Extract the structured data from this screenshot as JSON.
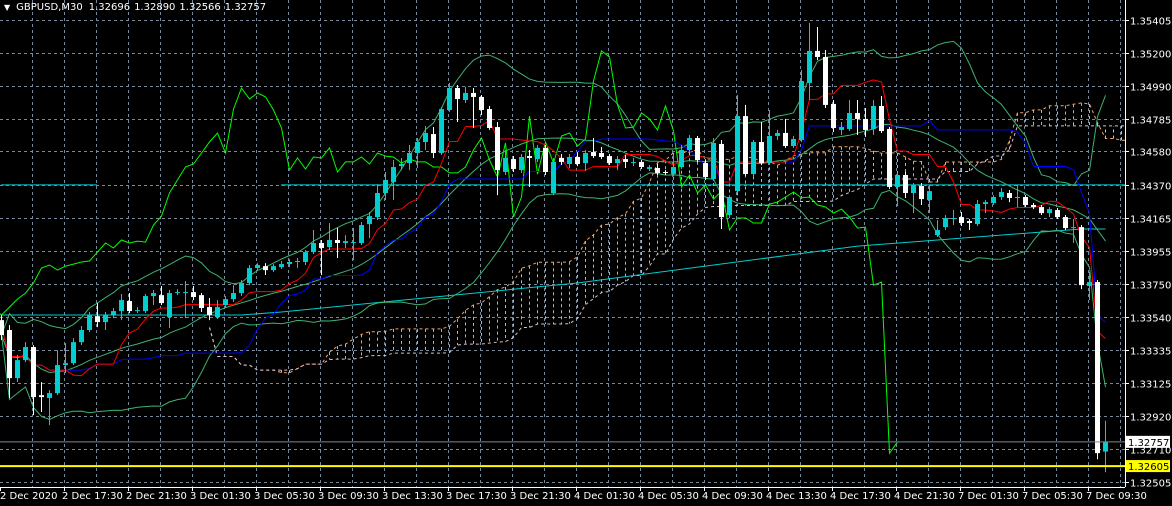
{
  "header": {
    "symbol": "GBPUSD,M30",
    "open": "1.32696",
    "high": "1.32890",
    "low": "1.32566",
    "close": "1.32757",
    "menu_icon": "triangle-down-icon"
  },
  "colors": {
    "background": "#000000",
    "grid": "#778899",
    "bull_candle": "#00CED1",
    "bear_candle": "#FFFFFF",
    "tenkan": "#FF0000",
    "kijun": "#0000FF",
    "senkou_a": "#F4A460",
    "senkou_b": "#D8BFD8",
    "chikou": "#00FF00",
    "bollinger": "#3CB371",
    "moving_average": "#00CED1",
    "bid_line": "#778899",
    "level_line": "#FFFF00"
  },
  "chart_data": {
    "type": "candlestick",
    "symbol": "GBPUSD",
    "timeframe": "M30",
    "indicators": [
      "Ichimoku Kinko Hyo (9,26,52)",
      "Bollinger Bands (20,2)",
      "Moving Average"
    ],
    "grid": true,
    "ylim": [
      1.32455,
      1.3553
    ],
    "y_ticks": [
      "1.35405",
      "1.35200",
      "1.34990",
      "1.34785",
      "1.34580",
      "1.34370",
      "1.34165",
      "1.33955",
      "1.33750",
      "1.33540",
      "1.33335",
      "1.33125",
      "1.32920",
      "1.32710",
      "1.32505"
    ],
    "x_ticks": [
      "2 Dec 2020",
      "2 Dec 17:30",
      "2 Dec 21:30",
      "3 Dec 01:30",
      "3 Dec 05:30",
      "3 Dec 09:30",
      "3 Dec 13:30",
      "3 Dec 17:30",
      "3 Dec 21:30",
      "4 Dec 01:30",
      "4 Dec 05:30",
      "4 Dec 09:30",
      "4 Dec 13:30",
      "4 Dec 17:30",
      "4 Dec 21:30",
      "7 Dec 01:30",
      "7 Dec 05:30",
      "7 Dec 09:30"
    ],
    "current_price": "1.32757",
    "horizontal_level": "1.32605",
    "candle_fields": [
      "open",
      "high",
      "low",
      "close"
    ],
    "candles": [
      [
        1.33521,
        1.33553,
        1.33396,
        1.33427
      ],
      [
        1.33459,
        1.3349,
        1.33032,
        1.33157
      ],
      [
        1.33157,
        1.33302,
        1.33132,
        1.3327
      ],
      [
        1.3327,
        1.33383,
        1.33258,
        1.33352
      ],
      [
        1.33352,
        1.33364,
        1.32925,
        1.33038
      ],
      [
        1.3305,
        1.33132,
        1.32944,
        1.33038
      ],
      [
        1.33032,
        1.33082,
        1.32862,
        1.33063
      ],
      [
        1.33063,
        1.33333,
        1.3305,
        1.33239
      ],
      [
        1.33239,
        1.33377,
        1.33189,
        1.33251
      ],
      [
        1.33251,
        1.33408,
        1.33239,
        1.33383
      ],
      [
        1.33383,
        1.33484,
        1.33364,
        1.33459
      ],
      [
        1.33459,
        1.33572,
        1.33446,
        1.33553
      ],
      [
        1.33546,
        1.33628,
        1.33477,
        1.33509
      ],
      [
        1.33509,
        1.33572,
        1.33459,
        1.33553
      ],
      [
        1.33553,
        1.33597,
        1.33534,
        1.33578
      ],
      [
        1.33578,
        1.33685,
        1.33521,
        1.33647
      ],
      [
        1.33641,
        1.33691,
        1.33565,
        1.33578
      ],
      [
        1.33584,
        1.33603,
        1.33565,
        1.33584
      ],
      [
        1.33578,
        1.33685,
        1.33565,
        1.33672
      ],
      [
        1.33672,
        1.3371,
        1.33616,
        1.33691
      ],
      [
        1.33678,
        1.33735,
        1.33616,
        1.33628
      ],
      [
        1.3354,
        1.3371,
        1.33471,
        1.33691
      ],
      [
        1.33691,
        1.33716,
        1.33678,
        1.33697
      ],
      [
        1.33697,
        1.33766,
        1.33534,
        1.33697
      ],
      [
        1.33697,
        1.33735,
        1.33647,
        1.33666
      ],
      [
        1.33678,
        1.33691,
        1.33572,
        1.33597
      ],
      [
        1.33603,
        1.3366,
        1.33521,
        1.33553
      ],
      [
        1.3354,
        1.33647,
        1.33528,
        1.33603
      ],
      [
        1.33616,
        1.33672,
        1.33597,
        1.33653
      ],
      [
        1.33653,
        1.33741,
        1.33634,
        1.33691
      ],
      [
        1.33691,
        1.33773,
        1.33672,
        1.33754
      ],
      [
        1.33754,
        1.33867,
        1.33741,
        1.33848
      ],
      [
        1.33848,
        1.33879,
        1.33835,
        1.33867
      ],
      [
        1.3386,
        1.33879,
        1.33804,
        1.33835
      ],
      [
        1.33835,
        1.33873,
        1.33823,
        1.3386
      ],
      [
        1.33854,
        1.33892,
        1.33842,
        1.33873
      ],
      [
        1.33873,
        1.33904,
        1.33854,
        1.33886
      ],
      [
        1.33886,
        1.33911,
        1.33848,
        1.33892
      ],
      [
        1.33886,
        1.33961,
        1.33867,
        1.33948
      ],
      [
        1.33948,
        1.34087,
        1.33936,
        1.34005
      ],
      [
        1.34005,
        1.34024,
        1.33804,
        1.33974
      ],
      [
        1.3398,
        1.34131,
        1.33961,
        1.34024
      ],
      [
        1.34024,
        1.34099,
        1.33911,
        1.34005
      ],
      [
        1.34005,
        1.34055,
        1.33974,
        1.34017
      ],
      [
        1.34005,
        1.34099,
        1.33898,
        1.34011
      ],
      [
        1.34005,
        1.34137,
        1.33992,
        1.34118
      ],
      [
        1.34124,
        1.342,
        1.34036,
        1.34174
      ],
      [
        1.34168,
        1.34375,
        1.34149,
        1.34319
      ],
      [
        1.34319,
        1.34451,
        1.34275,
        1.34401
      ],
      [
        1.34388,
        1.34526,
        1.34275,
        1.34482
      ],
      [
        1.34488,
        1.34539,
        1.34463,
        1.34501
      ],
      [
        1.34507,
        1.3462,
        1.34463,
        1.3457
      ],
      [
        1.3457,
        1.34664,
        1.34476,
        1.34639
      ],
      [
        1.34639,
        1.3474,
        1.34589,
        1.34696
      ],
      [
        1.34689,
        1.34733,
        1.34539,
        1.3457
      ],
      [
        1.3457,
        1.34859,
        1.34558,
        1.34846
      ],
      [
        1.3484,
        1.3501,
        1.34828,
        1.34978
      ],
      [
        1.34978,
        1.34997,
        1.34765,
        1.34909
      ],
      [
        1.34903,
        1.34985,
        1.34884,
        1.34947
      ],
      [
        1.34947,
        1.34978,
        1.34727,
        1.34922
      ],
      [
        1.34922,
        1.34934,
        1.34809,
        1.3484
      ],
      [
        1.34846,
        1.34865,
        1.34715,
        1.34727
      ],
      [
        1.34733,
        1.34765,
        1.34306,
        1.34463
      ],
      [
        1.34451,
        1.34589,
        1.34432,
        1.34539
      ],
      [
        1.34532,
        1.34551,
        1.34451,
        1.3447
      ],
      [
        1.34463,
        1.34564,
        1.34445,
        1.34545
      ],
      [
        1.34551,
        1.34589,
        1.34357,
        1.34539
      ],
      [
        1.34532,
        1.3462,
        1.34514,
        1.34602
      ],
      [
        1.34602,
        1.3462,
        1.34432,
        1.34451
      ],
      [
        1.34319,
        1.34539,
        1.34306,
        1.34514
      ],
      [
        1.34539,
        1.34564,
        1.34495,
        1.34514
      ],
      [
        1.34501,
        1.34564,
        1.34476,
        1.34545
      ],
      [
        1.34545,
        1.34576,
        1.34488,
        1.34501
      ],
      [
        1.34507,
        1.34589,
        1.34457,
        1.3457
      ],
      [
        1.34576,
        1.34664,
        1.34539,
        1.34551
      ],
      [
        1.3457,
        1.34608,
        1.34532,
        1.34545
      ],
      [
        1.34551,
        1.34564,
        1.34495,
        1.34507
      ],
      [
        1.34507,
        1.34551,
        1.34463,
        1.34532
      ],
      [
        1.34532,
        1.34558,
        1.34476,
        1.34514
      ],
      [
        1.34514,
        1.34539,
        1.34488,
        1.34514
      ],
      [
        1.34514,
        1.34526,
        1.3447,
        1.34482
      ],
      [
        1.3447,
        1.34495,
        1.34457,
        1.34482
      ],
      [
        1.34476,
        1.34501,
        1.34432,
        1.34445
      ],
      [
        1.34451,
        1.34463,
        1.34432,
        1.34445
      ],
      [
        1.34438,
        1.34551,
        1.34426,
        1.34482
      ],
      [
        1.34482,
        1.3462,
        1.3447,
        1.34589
      ],
      [
        1.34589,
        1.34683,
        1.34576,
        1.34664
      ],
      [
        1.34664,
        1.34677,
        1.34514,
        1.34526
      ],
      [
        1.34507,
        1.34526,
        1.34401,
        1.34419
      ],
      [
        1.34407,
        1.34664,
        1.34394,
        1.34633
      ],
      [
        1.34627,
        1.34652,
        1.34093,
        1.34168
      ],
      [
        1.34181,
        1.34306,
        1.34162,
        1.34294
      ],
      [
        1.34331,
        1.34934,
        1.34319,
        1.34802
      ],
      [
        1.34802,
        1.34872,
        1.34426,
        1.34438
      ],
      [
        1.34438,
        1.34652,
        1.34426,
        1.34639
      ],
      [
        1.34639,
        1.34765,
        1.34495,
        1.34507
      ],
      [
        1.34507,
        1.3484,
        1.34495,
        1.34677
      ],
      [
        1.34677,
        1.34715,
        1.34652,
        1.34696
      ],
      [
        1.34696,
        1.34784,
        1.34602,
        1.34614
      ],
      [
        1.34614,
        1.34677,
        1.34602,
        1.34658
      ],
      [
        1.34652,
        1.35091,
        1.34639,
        1.35022
      ],
      [
        1.3501,
        1.35387,
        1.34903,
        1.35211
      ],
      [
        1.35211,
        1.35361,
        1.35154,
        1.35173
      ],
      [
        1.35173,
        1.35217,
        1.34853,
        1.34872
      ],
      [
        1.34878,
        1.34903,
        1.34702,
        1.34727
      ],
      [
        1.34715,
        1.34765,
        1.34683,
        1.34733
      ],
      [
        1.34721,
        1.34903,
        1.34708,
        1.34821
      ],
      [
        1.34821,
        1.34903,
        1.34683,
        1.34784
      ],
      [
        1.34784,
        1.34853,
        1.34671,
        1.34715
      ],
      [
        1.34721,
        1.34903,
        1.34683,
        1.34865
      ],
      [
        1.34865,
        1.34928,
        1.34696,
        1.34708
      ],
      [
        1.34721,
        1.34733,
        1.34344,
        1.34357
      ],
      [
        1.34357,
        1.34445,
        1.34237,
        1.34432
      ],
      [
        1.34432,
        1.34451,
        1.34288,
        1.34319
      ],
      [
        1.34319,
        1.34382,
        1.34193,
        1.34369
      ],
      [
        1.34363,
        1.34382,
        1.34244,
        1.34281
      ],
      [
        1.34275,
        1.34369,
        1.34193,
        1.34331
      ],
      [
        1.34055,
        1.34149,
        1.34043,
        1.34087
      ],
      [
        1.34105,
        1.34181,
        1.34087,
        1.34162
      ],
      [
        1.34156,
        1.34212,
        1.34118,
        1.34162
      ],
      [
        1.34168,
        1.342,
        1.34112,
        1.34131
      ],
      [
        1.34143,
        1.34156,
        1.34087,
        1.34131
      ],
      [
        1.34124,
        1.34275,
        1.34112,
        1.3425
      ],
      [
        1.3425,
        1.34275,
        1.34193,
        1.34262
      ],
      [
        1.34256,
        1.34306,
        1.34244,
        1.34294
      ],
      [
        1.34294,
        1.3435,
        1.34275,
        1.34325
      ],
      [
        1.34319,
        1.34338,
        1.34262,
        1.34288
      ],
      [
        1.34294,
        1.34369,
        1.34231,
        1.34294
      ],
      [
        1.34294,
        1.34306,
        1.34231,
        1.34244
      ],
      [
        1.34244,
        1.34256,
        1.34218,
        1.34231
      ],
      [
        1.34231,
        1.34244,
        1.34181,
        1.34193
      ],
      [
        1.34193,
        1.34231,
        1.34168,
        1.34218
      ],
      [
        1.34212,
        1.34225,
        1.34156,
        1.34168
      ],
      [
        1.34168,
        1.34181,
        1.34087,
        1.34099
      ],
      [
        1.34099,
        1.34156,
        1.34005,
        1.34105
      ],
      [
        1.34105,
        1.34118,
        1.33716,
        1.33741
      ],
      [
        1.33735,
        1.33823,
        1.33647,
        1.3376
      ],
      [
        1.3376,
        1.33773,
        1.32648,
        1.32686
      ],
      [
        1.32696,
        1.3289,
        1.32566,
        1.32757
      ]
    ],
    "moving_average_anchors": [
      {
        "bar": 0,
        "price": 1.33553
      },
      {
        "bar": 30,
        "price": 1.33553
      },
      {
        "bar": 35,
        "price": 1.33572
      },
      {
        "bar": 72,
        "price": 1.33754
      },
      {
        "bar": 107,
        "price": 1.33986
      },
      {
        "bar": 135,
        "price": 1.34093
      },
      {
        "bar": 138,
        "price": 1.34093
      }
    ],
    "cyan_level": {
      "price": 1.3437,
      "segments": [
        [
          0,
          12
        ],
        [
          35,
          141
        ]
      ]
    }
  }
}
